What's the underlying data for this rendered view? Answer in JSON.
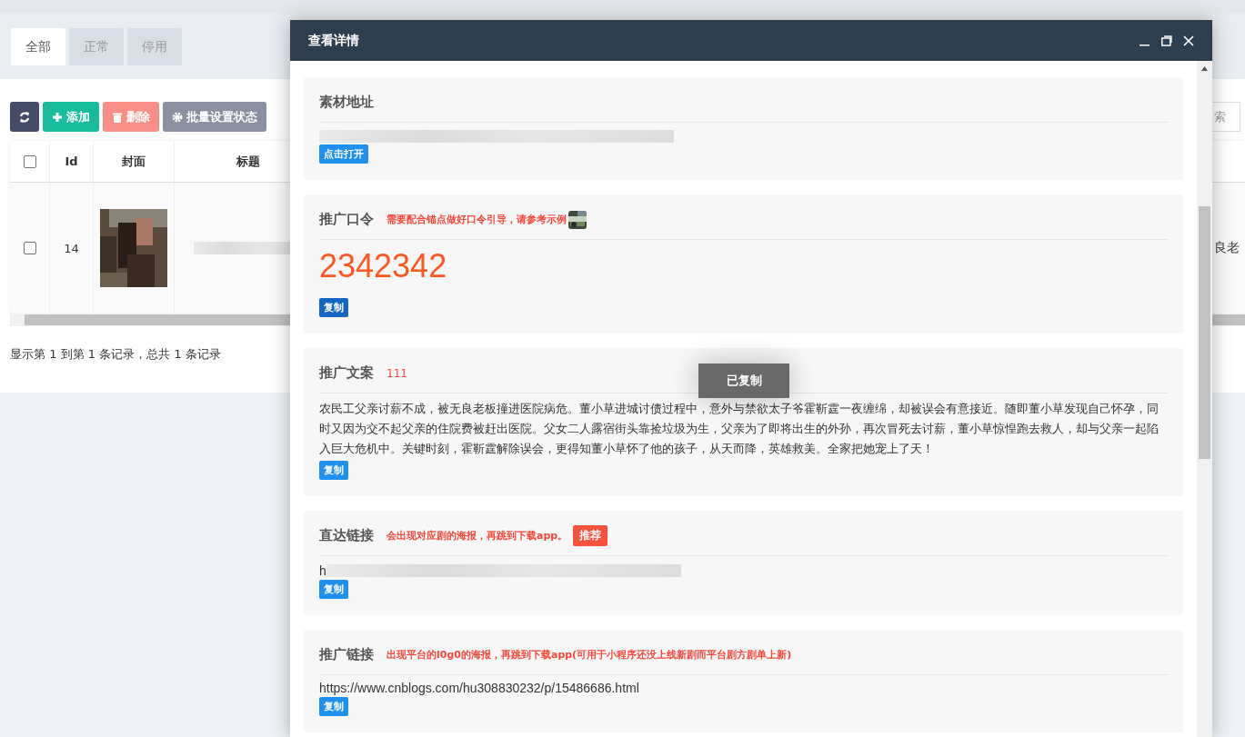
{
  "tabs": [
    {
      "label": "全部",
      "selected": true
    },
    {
      "label": "正常",
      "selected": false
    },
    {
      "label": "停用",
      "selected": false
    }
  ],
  "toolbar": {
    "buttons": [
      {
        "kind": "refresh",
        "color": "#444c69"
      },
      {
        "kind": "add",
        "label": "添加",
        "color": "#18bc9c"
      },
      {
        "kind": "delete",
        "label": "删除",
        "color": "#f98e86"
      },
      {
        "kind": "settings",
        "label": "批量设置状态",
        "color": "#8a8fa1"
      }
    ],
    "search": {
      "placeholder": "索"
    }
  },
  "table": {
    "columns": [
      {
        "kind": "check",
        "checked": false
      },
      {
        "kind": "text",
        "label": "Id"
      },
      {
        "kind": "text",
        "label": "封面"
      },
      {
        "kind": "text",
        "label": "标题"
      },
      {
        "kind": "blank"
      }
    ],
    "rows": [
      {
        "checked": false,
        "id": "14",
        "column_5": "良老"
      }
    ]
  },
  "pagination": {
    "summary": "显示第 1 到第 1 条记录，总共 1 条记录"
  },
  "dialog": {
    "title": "查看详情",
    "sections": [
      {
        "title": "素材地址",
        "value": {
          "kind": "redacted"
        },
        "button": {
          "label": "点击打开",
          "kind": "open"
        }
      },
      {
        "title": "推广口令",
        "hint": "需要配合锚点做好口令引导，请参考示例",
        "hint_bold": true,
        "value": {
          "kind": "code",
          "text": "2342342"
        },
        "button": {
          "label": "复制",
          "kind": "copy-dark"
        }
      },
      {
        "title": "推广文案",
        "hint": "111",
        "hint_bold": false,
        "value": {
          "kind": "paragraph",
          "text": "农民工父亲讨薪不成，被无良老板撞进医院病危。董小草进城讨债过程中，意外与禁欲太子爷霍靳霆一夜缠绵，却被误会有意接近。随即董小草发现自己怀孕，同时又因为交不起父亲的住院费被赶出医院。父女二人露宿街头靠捡垃圾为生，父亲为了即将出生的外孙，再次冒死去讨薪，董小草惊惶跑去救人，却与父亲一起陷入巨大危机中。关键时刻，霍靳霆解除误会，更得知董小草怀了他的孩子，从天而降，英雄救美。全家把她宠上了天！"
        },
        "button": {
          "label": "复制",
          "kind": "copy"
        }
      },
      {
        "title": "直达链接",
        "hint": "会出现对应剧的海报，再跳到下载app。",
        "hint_bold": true,
        "badge": "推荐",
        "value": {
          "kind": "redacted",
          "text": "h"
        },
        "button": {
          "label": "复制",
          "kind": "copy"
        }
      },
      {
        "title": "推广链接",
        "hint": "出现平台的l0g0的海报，再跳到下载app(可用于小程序还没上线新剧而平台剧方剧单上新)",
        "hint_bold": true,
        "value": {
          "kind": "url",
          "text": "https://www.cnblogs.com/hu308830232/p/15486686.html"
        },
        "button": {
          "label": "复制",
          "kind": "copy"
        }
      }
    ]
  },
  "toast": {
    "text": "已复制"
  }
}
